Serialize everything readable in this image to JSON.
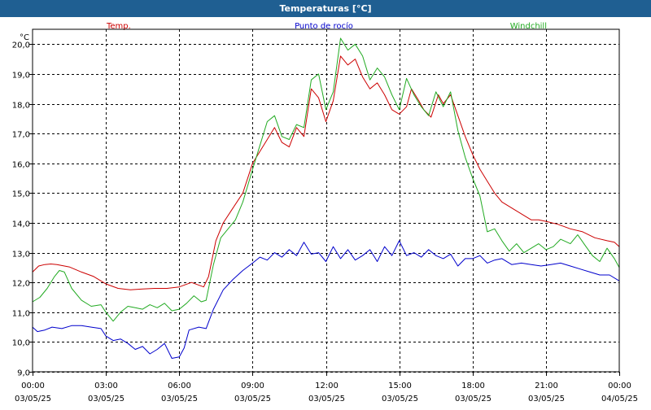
{
  "window": {
    "title": "Temperaturas [°C]"
  },
  "chart_data": {
    "type": "line",
    "title": "Temperaturas [°C]",
    "ylabel": "°C",
    "xlabel": "",
    "ylim": [
      9.0,
      20.5
    ],
    "y_ticks": [
      "9,0",
      "10,0",
      "11,0",
      "12,0",
      "13,0",
      "14,0",
      "15,0",
      "16,0",
      "17,0",
      "18,0",
      "19,0",
      "20,0"
    ],
    "y_tick_values": [
      9,
      10,
      11,
      12,
      13,
      14,
      15,
      16,
      17,
      18,
      19,
      20
    ],
    "xlim": [
      0,
      24
    ],
    "x_ticks": [
      {
        "h": 0,
        "time": "00:00",
        "date": "03/05/25"
      },
      {
        "h": 3,
        "time": "03:00",
        "date": "03/05/25"
      },
      {
        "h": 6,
        "time": "06:00",
        "date": "03/05/25"
      },
      {
        "h": 9,
        "time": "09:00",
        "date": "03/05/25"
      },
      {
        "h": 12,
        "time": "12:00",
        "date": "03/05/25"
      },
      {
        "h": 15,
        "time": "15:00",
        "date": "03/05/25"
      },
      {
        "h": 18,
        "time": "18:00",
        "date": "03/05/25"
      },
      {
        "h": 21,
        "time": "21:00",
        "date": "03/05/25"
      },
      {
        "h": 24,
        "time": "00:00",
        "date": "04/05/25"
      }
    ],
    "grid": true,
    "legend_placement": "top",
    "series": [
      {
        "name": "Temp.",
        "color": "#cc0000",
        "points": [
          [
            0,
            12.35
          ],
          [
            0.25,
            12.55
          ],
          [
            0.5,
            12.6
          ],
          [
            0.75,
            12.62
          ],
          [
            1.0,
            12.6
          ],
          [
            1.5,
            12.52
          ],
          [
            2.0,
            12.35
          ],
          [
            2.5,
            12.2
          ],
          [
            3.0,
            11.95
          ],
          [
            3.5,
            11.8
          ],
          [
            4.0,
            11.75
          ],
          [
            4.5,
            11.78
          ],
          [
            5.0,
            11.8
          ],
          [
            5.5,
            11.8
          ],
          [
            6.0,
            11.85
          ],
          [
            6.5,
            12.0
          ],
          [
            7.0,
            11.85
          ],
          [
            7.2,
            12.2
          ],
          [
            7.5,
            13.4
          ],
          [
            7.8,
            14.0
          ],
          [
            8.2,
            14.5
          ],
          [
            8.6,
            15.0
          ],
          [
            9.0,
            16.0
          ],
          [
            9.3,
            16.4
          ],
          [
            9.6,
            16.8
          ],
          [
            9.9,
            17.2
          ],
          [
            10.2,
            16.7
          ],
          [
            10.5,
            16.55
          ],
          [
            10.8,
            17.2
          ],
          [
            11.1,
            16.9
          ],
          [
            11.4,
            18.5
          ],
          [
            11.7,
            18.2
          ],
          [
            12.0,
            17.4
          ],
          [
            12.3,
            18.1
          ],
          [
            12.6,
            19.6
          ],
          [
            12.9,
            19.3
          ],
          [
            13.2,
            19.5
          ],
          [
            13.5,
            18.9
          ],
          [
            13.8,
            18.5
          ],
          [
            14.1,
            18.7
          ],
          [
            14.4,
            18.3
          ],
          [
            14.7,
            17.8
          ],
          [
            15.0,
            17.65
          ],
          [
            15.3,
            17.9
          ],
          [
            15.5,
            18.5
          ],
          [
            15.8,
            18.1
          ],
          [
            16.0,
            17.8
          ],
          [
            16.3,
            17.55
          ],
          [
            16.6,
            18.3
          ],
          [
            16.8,
            18.0
          ],
          [
            17.1,
            18.3
          ],
          [
            17.4,
            17.6
          ],
          [
            17.7,
            16.9
          ],
          [
            18.0,
            16.3
          ],
          [
            18.3,
            15.8
          ],
          [
            18.6,
            15.4
          ],
          [
            18.9,
            15.0
          ],
          [
            19.2,
            14.7
          ],
          [
            19.5,
            14.55
          ],
          [
            19.8,
            14.4
          ],
          [
            20.1,
            14.25
          ],
          [
            20.4,
            14.1
          ],
          [
            20.7,
            14.1
          ],
          [
            21.0,
            14.05
          ],
          [
            21.5,
            13.95
          ],
          [
            22.0,
            13.8
          ],
          [
            22.5,
            13.7
          ],
          [
            23.0,
            13.5
          ],
          [
            23.5,
            13.4
          ],
          [
            23.8,
            13.35
          ],
          [
            24.0,
            13.2
          ]
        ]
      },
      {
        "name": "Punto de rocío",
        "color": "#0000cc",
        "points": [
          [
            0,
            10.5
          ],
          [
            0.2,
            10.35
          ],
          [
            0.5,
            10.4
          ],
          [
            0.8,
            10.5
          ],
          [
            1.2,
            10.45
          ],
          [
            1.6,
            10.55
          ],
          [
            2.0,
            10.55
          ],
          [
            2.4,
            10.5
          ],
          [
            2.8,
            10.45
          ],
          [
            3.0,
            10.2
          ],
          [
            3.3,
            10.05
          ],
          [
            3.6,
            10.1
          ],
          [
            3.9,
            9.95
          ],
          [
            4.2,
            9.75
          ],
          [
            4.5,
            9.85
          ],
          [
            4.8,
            9.6
          ],
          [
            5.1,
            9.75
          ],
          [
            5.4,
            9.95
          ],
          [
            5.7,
            9.45
          ],
          [
            6.0,
            9.5
          ],
          [
            6.2,
            9.8
          ],
          [
            6.4,
            10.4
          ],
          [
            6.8,
            10.5
          ],
          [
            7.1,
            10.45
          ],
          [
            7.4,
            11.1
          ],
          [
            7.8,
            11.75
          ],
          [
            8.2,
            12.1
          ],
          [
            8.6,
            12.4
          ],
          [
            9.0,
            12.65
          ],
          [
            9.3,
            12.85
          ],
          [
            9.6,
            12.75
          ],
          [
            9.9,
            13.0
          ],
          [
            10.2,
            12.85
          ],
          [
            10.5,
            13.1
          ],
          [
            10.8,
            12.9
          ],
          [
            11.1,
            13.35
          ],
          [
            11.4,
            12.95
          ],
          [
            11.7,
            13.0
          ],
          [
            12.0,
            12.7
          ],
          [
            12.3,
            13.2
          ],
          [
            12.6,
            12.8
          ],
          [
            12.9,
            13.1
          ],
          [
            13.2,
            12.75
          ],
          [
            13.5,
            12.9
          ],
          [
            13.8,
            13.1
          ],
          [
            14.1,
            12.7
          ],
          [
            14.4,
            13.2
          ],
          [
            14.7,
            12.9
          ],
          [
            15.0,
            13.4
          ],
          [
            15.3,
            12.9
          ],
          [
            15.6,
            13.0
          ],
          [
            15.9,
            12.85
          ],
          [
            16.2,
            13.1
          ],
          [
            16.5,
            12.9
          ],
          [
            16.8,
            12.8
          ],
          [
            17.1,
            12.95
          ],
          [
            17.4,
            12.55
          ],
          [
            17.7,
            12.8
          ],
          [
            18.0,
            12.8
          ],
          [
            18.3,
            12.9
          ],
          [
            18.6,
            12.65
          ],
          [
            18.9,
            12.75
          ],
          [
            19.2,
            12.8
          ],
          [
            19.6,
            12.6
          ],
          [
            20.0,
            12.65
          ],
          [
            20.4,
            12.6
          ],
          [
            20.8,
            12.55
          ],
          [
            21.2,
            12.6
          ],
          [
            21.6,
            12.65
          ],
          [
            22.0,
            12.55
          ],
          [
            22.4,
            12.45
          ],
          [
            22.8,
            12.35
          ],
          [
            23.2,
            12.25
          ],
          [
            23.6,
            12.25
          ],
          [
            24.0,
            12.05
          ]
        ]
      },
      {
        "name": "Windchill",
        "color": "#22aa22",
        "points": [
          [
            0,
            11.35
          ],
          [
            0.3,
            11.5
          ],
          [
            0.6,
            11.8
          ],
          [
            0.9,
            12.2
          ],
          [
            1.1,
            12.4
          ],
          [
            1.3,
            12.35
          ],
          [
            1.6,
            11.8
          ],
          [
            2.0,
            11.4
          ],
          [
            2.4,
            11.2
          ],
          [
            2.8,
            11.25
          ],
          [
            3.0,
            11.0
          ],
          [
            3.3,
            10.7
          ],
          [
            3.6,
            11.0
          ],
          [
            3.9,
            11.2
          ],
          [
            4.2,
            11.15
          ],
          [
            4.5,
            11.1
          ],
          [
            4.8,
            11.25
          ],
          [
            5.1,
            11.15
          ],
          [
            5.4,
            11.3
          ],
          [
            5.7,
            11.05
          ],
          [
            6.0,
            11.1
          ],
          [
            6.3,
            11.3
          ],
          [
            6.6,
            11.55
          ],
          [
            6.9,
            11.35
          ],
          [
            7.1,
            11.4
          ],
          [
            7.4,
            12.6
          ],
          [
            7.7,
            13.5
          ],
          [
            8.0,
            13.8
          ],
          [
            8.3,
            14.1
          ],
          [
            8.6,
            14.7
          ],
          [
            9.0,
            15.8
          ],
          [
            9.3,
            16.6
          ],
          [
            9.6,
            17.4
          ],
          [
            9.9,
            17.6
          ],
          [
            10.2,
            16.9
          ],
          [
            10.5,
            16.8
          ],
          [
            10.8,
            17.3
          ],
          [
            11.1,
            17.2
          ],
          [
            11.4,
            18.8
          ],
          [
            11.7,
            19.0
          ],
          [
            12.0,
            17.8
          ],
          [
            12.3,
            18.4
          ],
          [
            12.6,
            20.2
          ],
          [
            12.9,
            19.8
          ],
          [
            13.2,
            20.0
          ],
          [
            13.5,
            19.6
          ],
          [
            13.8,
            18.8
          ],
          [
            14.1,
            19.2
          ],
          [
            14.4,
            18.9
          ],
          [
            14.7,
            18.3
          ],
          [
            15.0,
            17.8
          ],
          [
            15.3,
            18.85
          ],
          [
            15.6,
            18.3
          ],
          [
            15.9,
            17.9
          ],
          [
            16.2,
            17.6
          ],
          [
            16.5,
            18.4
          ],
          [
            16.8,
            17.9
          ],
          [
            17.1,
            18.4
          ],
          [
            17.4,
            17.1
          ],
          [
            17.7,
            16.2
          ],
          [
            18.0,
            15.5
          ],
          [
            18.3,
            14.9
          ],
          [
            18.6,
            13.7
          ],
          [
            18.9,
            13.8
          ],
          [
            19.2,
            13.4
          ],
          [
            19.5,
            13.05
          ],
          [
            19.8,
            13.3
          ],
          [
            20.1,
            13.0
          ],
          [
            20.4,
            13.15
          ],
          [
            20.7,
            13.3
          ],
          [
            21.0,
            13.1
          ],
          [
            21.3,
            13.2
          ],
          [
            21.6,
            13.45
          ],
          [
            22.0,
            13.3
          ],
          [
            22.3,
            13.6
          ],
          [
            22.6,
            13.25
          ],
          [
            22.9,
            12.9
          ],
          [
            23.2,
            12.7
          ],
          [
            23.5,
            13.15
          ],
          [
            23.8,
            12.8
          ],
          [
            24.0,
            12.5
          ]
        ]
      }
    ]
  }
}
